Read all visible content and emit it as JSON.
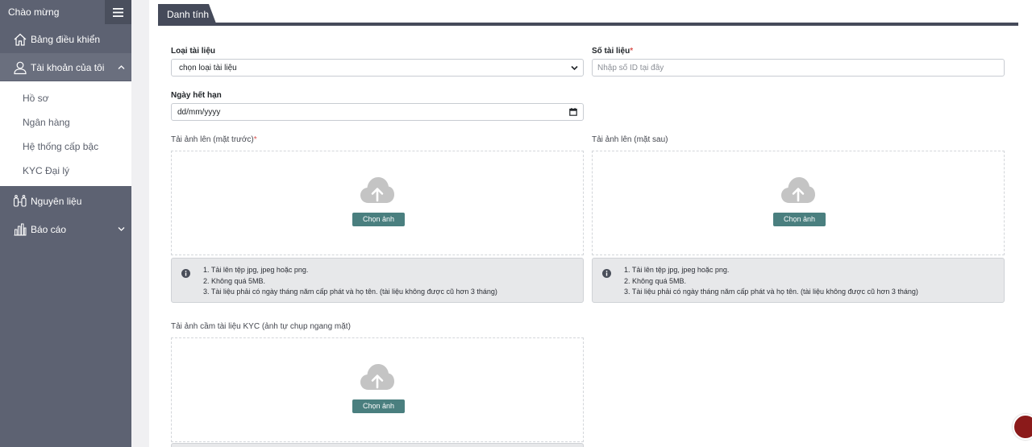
{
  "sidebar": {
    "welcome": "Chào mừng",
    "items": [
      {
        "label": "Bảng điều khiển"
      },
      {
        "label": "Tài khoản của tôi"
      },
      {
        "label": "Nguyên liệu"
      },
      {
        "label": "Báo cáo"
      }
    ],
    "subitems": [
      "Hồ sơ",
      "Ngân hàng",
      "Hệ thống cấp bậc",
      "KYC Đại lý"
    ]
  },
  "tab": {
    "label": "Danh tính"
  },
  "form": {
    "doc_type_label": "Loại tài liệu",
    "doc_type_value": "chọn loại tài liệu",
    "doc_number_label": "Số tài liệu",
    "doc_number_placeholder": "Nhập số ID tại đây",
    "required_mark": "*",
    "expiry_label": "Ngày hết hạn",
    "expiry_value": "dd/mm/yyyy",
    "front_label": "Tải ảnh lên (mặt trước)",
    "back_label": "Tải ảnh lên (mặt sau)",
    "kyc_label": "Tải ảnh cầm tài liệu KYC (ảnh tự chụp ngang mặt)",
    "choose_button": "Chọn ảnh",
    "notes": [
      "1. Tải lên tệp jpg, jpeg hoặc png.",
      "2. Không quá 5MB.",
      "3. Tài liệu phải có ngày tháng năm cấp phát và họ tên. (tài liệu không được cũ hơn 3 tháng)"
    ]
  }
}
